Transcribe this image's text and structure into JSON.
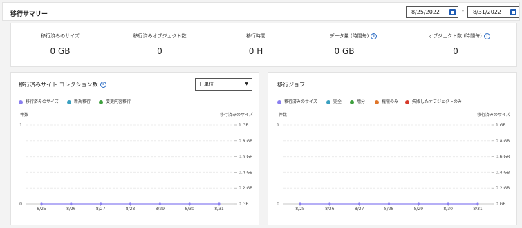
{
  "header": {
    "title": "移行サマリー",
    "date_from": "8/25/2022",
    "date_separator": "-",
    "date_to": "8/31/2022"
  },
  "summary": [
    {
      "label": "移行済みのサイズ",
      "value": "0 GB",
      "info": false
    },
    {
      "label": "移行済みオブジェクト数",
      "value": "0",
      "info": false
    },
    {
      "label": "移行時間",
      "value": "0 H",
      "info": false
    },
    {
      "label": "データ量 (時間毎)",
      "value": "0 GB",
      "info": true
    },
    {
      "label": "オブジェクト数 (時間毎)",
      "value": "0",
      "info": true
    }
  ],
  "left_panel": {
    "title": "移行済みサイト コレクション数",
    "select_value": "日単位",
    "legend": [
      {
        "label": "移行済みのサイズ",
        "color": "#8a7ff0"
      },
      {
        "label": "新規移行",
        "color": "#3aa0c0"
      },
      {
        "label": "変更内容移行",
        "color": "#3fa03f"
      }
    ],
    "left_axis_title": "件数",
    "right_axis_title": "移行済みのサイズ"
  },
  "right_panel": {
    "title": "移行ジョブ",
    "legend": [
      {
        "label": "移行済みのサイズ",
        "color": "#8a7ff0"
      },
      {
        "label": "完全",
        "color": "#3aa0c0"
      },
      {
        "label": "増分",
        "color": "#3fa03f"
      },
      {
        "label": "権限のみ",
        "color": "#e0762a"
      },
      {
        "label": "失敗したオブジェクトのみ",
        "color": "#d63a2a"
      }
    ],
    "left_axis_title": "件数",
    "right_axis_title": "移行済みのサイズ"
  },
  "chart_data": [
    {
      "type": "line",
      "categories": [
        "8/25",
        "8/26",
        "8/27",
        "8/28",
        "8/29",
        "8/30",
        "8/31"
      ],
      "y_left_ticks": [
        "0",
        "1"
      ],
      "y_right_ticks": [
        "0 GB",
        "0.2 GB",
        "0.4 GB",
        "0.6 GB",
        "0.8 GB",
        "1 GB"
      ],
      "ylim": [
        0,
        1
      ],
      "grid": true,
      "series": [
        {
          "name": "移行済みのサイズ",
          "values": [
            0,
            0,
            0,
            0,
            0,
            0,
            0
          ]
        }
      ]
    },
    {
      "type": "line",
      "categories": [
        "8/25",
        "8/26",
        "8/27",
        "8/28",
        "8/29",
        "8/30",
        "8/31"
      ],
      "y_left_ticks": [
        "0",
        "1"
      ],
      "y_right_ticks": [
        "0 GB",
        "0.2 GB",
        "0.4 GB",
        "0.6 GB",
        "0.8 GB",
        "1 GB"
      ],
      "ylim": [
        0,
        1
      ],
      "grid": true,
      "series": [
        {
          "name": "移行済みのサイズ",
          "values": [
            0,
            0,
            0,
            0,
            0,
            0,
            0
          ]
        }
      ]
    }
  ]
}
